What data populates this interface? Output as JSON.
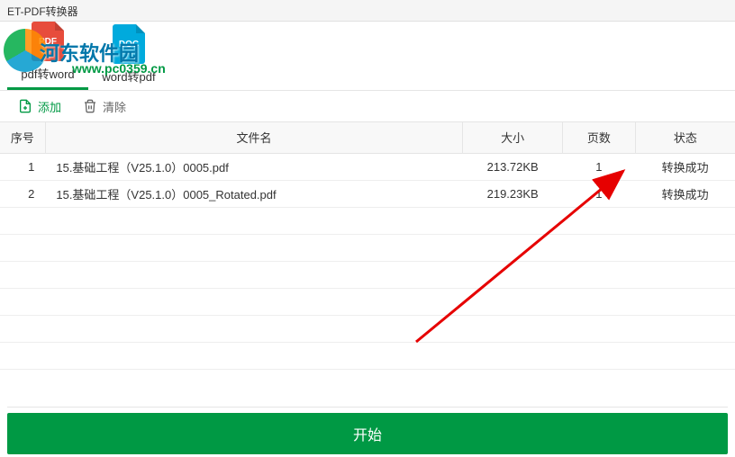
{
  "window": {
    "title": "ET-PDF转换器"
  },
  "watermark": {
    "text": "河东软件园",
    "url": "www.pc0359.cn"
  },
  "tabs": [
    {
      "label": "pdf转word",
      "icon_text": "PDF",
      "icon_type": "pdf",
      "active": true
    },
    {
      "label": "word转pdf",
      "icon_text": "DOC",
      "icon_type": "doc",
      "active": false
    }
  ],
  "toolbar": {
    "add_label": "添加",
    "clear_label": "清除"
  },
  "table": {
    "headers": {
      "index": "序号",
      "name": "文件名",
      "size": "大小",
      "pages": "页数",
      "status": "状态"
    },
    "rows": [
      {
        "index": "1",
        "name": "15.基础工程（V25.1.0）0005.pdf",
        "size": "213.72KB",
        "pages": "1",
        "status": "转换成功"
      },
      {
        "index": "2",
        "name": "15.基础工程（V25.1.0）0005_Rotated.pdf",
        "size": "219.23KB",
        "pages": "1",
        "status": "转换成功"
      }
    ]
  },
  "actions": {
    "start_label": "开始"
  }
}
